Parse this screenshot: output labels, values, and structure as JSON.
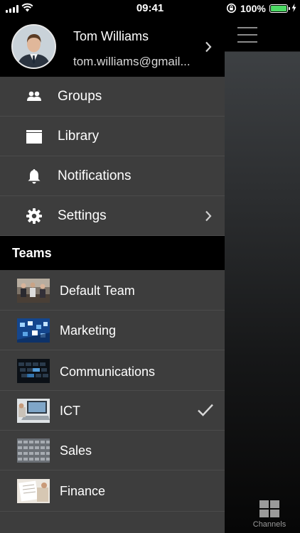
{
  "status_bar": {
    "time": "09:41",
    "battery": "100%",
    "battery_color": "#4cd964"
  },
  "profile": {
    "name": "Tom Williams",
    "email": "tom.williams@gmail..."
  },
  "menu": [
    {
      "label": "Groups",
      "icon": "groups-icon",
      "has_chevron": false
    },
    {
      "label": "Library",
      "icon": "library-icon",
      "has_chevron": false
    },
    {
      "label": "Notifications",
      "icon": "bell-icon",
      "has_chevron": false
    },
    {
      "label": "Settings",
      "icon": "gear-icon",
      "has_chevron": true
    }
  ],
  "teams": {
    "header": "Teams",
    "items": [
      {
        "label": "Default Team",
        "selected": false
      },
      {
        "label": "Marketing",
        "selected": false
      },
      {
        "label": "Communications",
        "selected": false
      },
      {
        "label": "ICT",
        "selected": true
      },
      {
        "label": "Sales",
        "selected": false
      },
      {
        "label": "Finance",
        "selected": false
      }
    ]
  },
  "tab_bar": {
    "channels_label": "Channels"
  }
}
